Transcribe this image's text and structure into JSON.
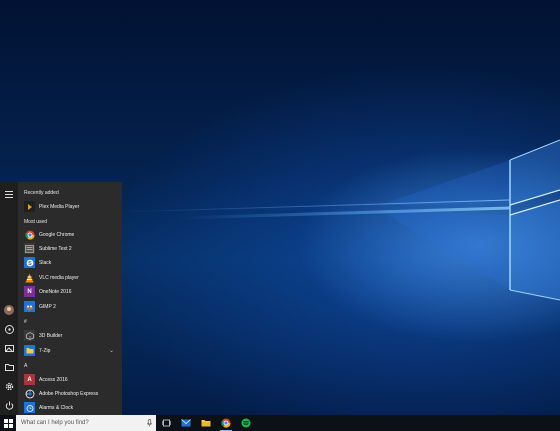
{
  "start_menu": {
    "recently_added_header": "Recently added",
    "most_used_header": "Most used",
    "recent_apps": [
      {
        "label": "Plex Media Player",
        "icon": "plex-icon",
        "color": "#1f1f1f"
      }
    ],
    "most_used_apps": [
      {
        "label": "Google Chrome",
        "icon": "chrome-icon",
        "color": "#2b2b2b"
      },
      {
        "label": "Sublime Text 2",
        "icon": "sublime-icon",
        "color": "#3a3a3a"
      },
      {
        "label": "Slack",
        "icon": "slack-icon",
        "color": "#1e73d8"
      },
      {
        "label": "VLC media player",
        "icon": "vlc-icon",
        "color": "#2b2b2b"
      },
      {
        "label": "OneNote 2016",
        "icon": "onenote-icon",
        "color": "#7b3096"
      },
      {
        "label": "GIMP 2",
        "icon": "gimp-icon",
        "color": "#1e73d8"
      }
    ],
    "hash_header": "#",
    "hash_apps": [
      {
        "label": "3D Builder",
        "icon": "3d-builder-icon",
        "color": "#3a3a3a"
      },
      {
        "label": "7-Zip",
        "icon": "folder-icon",
        "color": "#1e73d8"
      }
    ],
    "a_header": "A",
    "a_apps": [
      {
        "label": "Access 2016",
        "icon": "access-icon",
        "color": "#a4373a"
      },
      {
        "label": "Adobe Photoshop Express",
        "icon": "photoshop-express-icon",
        "color": "#2b2b2b"
      },
      {
        "label": "Alarms & Clock",
        "icon": "alarm-clock-icon",
        "color": "#1e73d8"
      }
    ],
    "tile_letters": {
      "access": "A",
      "onenote": "N"
    }
  },
  "taskbar": {
    "search_placeholder": "What can I help you find?",
    "accent": "#8ab4f8"
  }
}
